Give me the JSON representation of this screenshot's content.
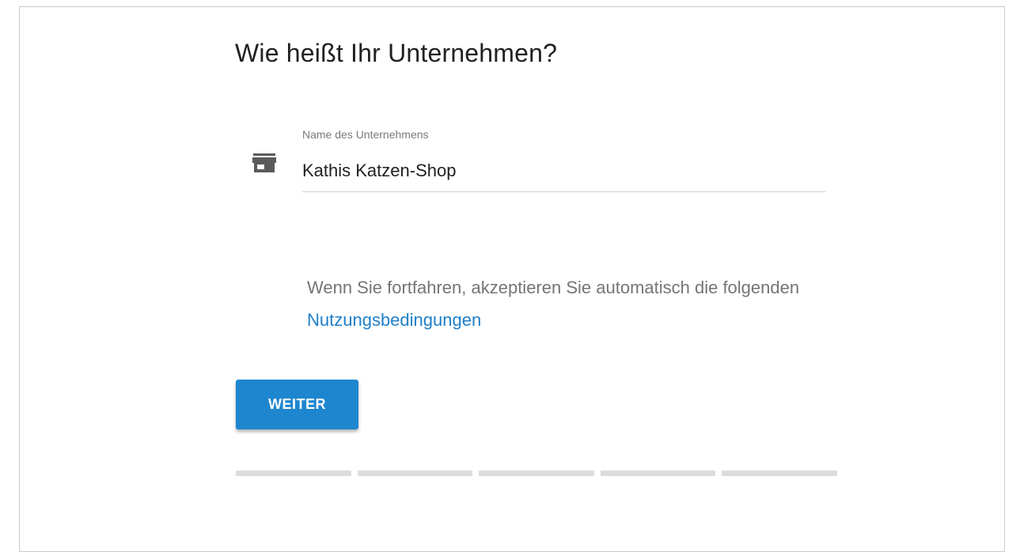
{
  "page": {
    "title": "Wie heißt Ihr Unternehmen?"
  },
  "company_field": {
    "label": "Name des Unternehmens",
    "value": "Kathis Katzen-Shop",
    "icon": "store-icon"
  },
  "terms": {
    "text_before": "Wenn Sie fortfahren, akzeptieren Sie automatisch die folgenden ",
    "link_label": "Nutzungsbedingungen"
  },
  "actions": {
    "continue_label": "WEITER"
  },
  "progress": {
    "total_steps": 5,
    "completed_steps": 0
  },
  "colors": {
    "accent": "#1e86cf",
    "link": "#1e7fc8",
    "progress_track": "#dcdcdc"
  }
}
